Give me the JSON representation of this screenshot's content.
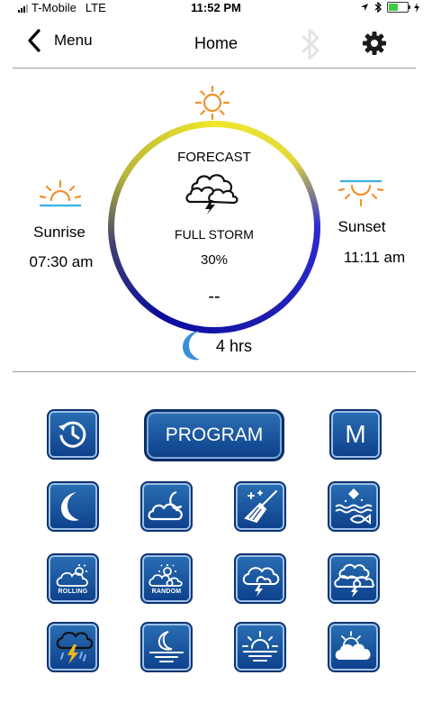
{
  "status": {
    "carrier": "T-Mobile",
    "network": "LTE",
    "time": "11:52 PM"
  },
  "nav": {
    "back_label": "Menu",
    "title": "Home"
  },
  "dial": {
    "forecast_label": "FORECAST",
    "condition": "FULL STORM",
    "percent": "30%",
    "value": "--",
    "moon_duration": "4 hrs"
  },
  "sunrise": {
    "label": "Sunrise",
    "time": "07:30 am"
  },
  "sunset": {
    "label": "Sunset",
    "time": "11:11 am"
  },
  "buttons": {
    "program_label": "PROGRAM",
    "m_label": "M",
    "rolling_label": "ROLLING",
    "random_label": "RANDOM"
  },
  "colors": {
    "accent_blue": "#1a5aa5",
    "sun_orange": "#f0902a",
    "moon_blue": "#3a8fd8"
  },
  "icons": [
    "signal-icon",
    "location-icon",
    "bluetooth-icon",
    "battery-icon",
    "back-chevron-icon",
    "gear-icon",
    "sun-icon",
    "sunrise-icon",
    "sunset-icon",
    "storm-cloud-icon",
    "moon-icon",
    "history-icon"
  ]
}
